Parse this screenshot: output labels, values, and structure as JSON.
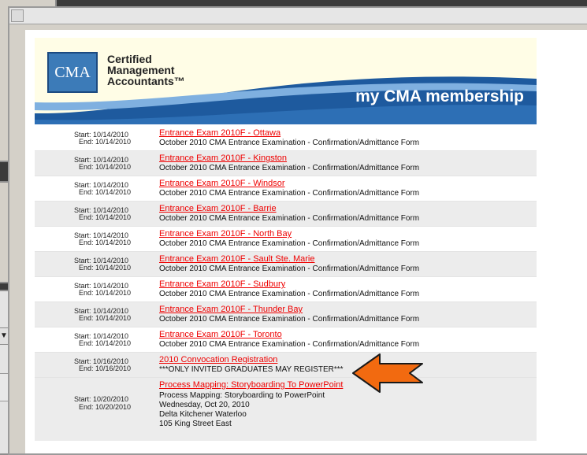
{
  "banner": {
    "logo_text": "CMA",
    "brand_lines": [
      "Certified",
      "Management",
      "Accountants™"
    ],
    "title": "my CMA membership",
    "colors": {
      "logo_blue": "#3c7bb8",
      "swoosh_blue": "#1e5a9e",
      "banner_bg": "#fffde6"
    }
  },
  "events": [
    {
      "start": "Start: 10/14/2010",
      "end": "End: 10/14/2010",
      "title": "Entrance Exam 2010F - Ottawa",
      "desc": "October 2010 CMA Entrance Examination - Confirmation/Admittance Form"
    },
    {
      "start": "Start: 10/14/2010",
      "end": "End: 10/14/2010",
      "title": "Entrance Exam 2010F - Kingston",
      "desc": "October 2010 CMA Entrance Examination - Confirmation/Admittance Form"
    },
    {
      "start": "Start: 10/14/2010",
      "end": "End: 10/14/2010",
      "title": "Entrance Exam 2010F - Windsor",
      "desc": "October 2010 CMA Entrance Examination - Confirmation/Admittance Form"
    },
    {
      "start": "Start: 10/14/2010",
      "end": "End: 10/14/2010",
      "title": "Entrance Exam 2010F - Barrie",
      "desc": "October 2010 CMA Entrance Examination - Confirmation/Admittance Form"
    },
    {
      "start": "Start: 10/14/2010",
      "end": "End: 10/14/2010",
      "title": "Entrance Exam 2010F - North Bay",
      "desc": "October 2010 CMA Entrance Examination - Confirmation/Admittance Form"
    },
    {
      "start": "Start: 10/14/2010",
      "end": "End: 10/14/2010",
      "title": "Entrance Exam 2010F - Sault Ste. Marie",
      "desc": "October 2010 CMA Entrance Examination - Confirmation/Admittance Form"
    },
    {
      "start": "Start: 10/14/2010",
      "end": "End: 10/14/2010",
      "title": "Entrance Exam 2010F - Sudbury",
      "desc": "October 2010 CMA Entrance Examination - Confirmation/Admittance Form"
    },
    {
      "start": "Start: 10/14/2010",
      "end": "End: 10/14/2010",
      "title": "Entrance Exam 2010F - Thunder Bay",
      "desc": "October 2010 CMA Entrance Examination - Confirmation/Admittance Form"
    },
    {
      "start": "Start: 10/14/2010",
      "end": "End: 10/14/2010",
      "title": "Entrance Exam 2010F - Toronto",
      "desc": "October 2010 CMA Entrance Examination - Confirmation/Admittance Form"
    },
    {
      "start": "Start: 10/16/2010",
      "end": "End: 10/16/2010",
      "title": "2010 Convocation Registration",
      "desc": "***ONLY INVITED GRADUATES MAY REGISTER***"
    }
  ],
  "last_event": {
    "start": "Start: 10/20/2010",
    "end": "End: 10/20/2010",
    "title": "Process Mapping: Storyboarding To PowerPoint",
    "lines": [
      "Process Mapping: Storyboarding to PowerPoint",
      "Wednesday, Oct 20, 2010",
      "Delta Kitchener Waterloo",
      "105 King Street East"
    ]
  },
  "background_windows": {
    "dropdown_arrow": "▼"
  },
  "annotation": {
    "arrow_color": "#f26a10",
    "arrow_outline": "#1a1a1a"
  }
}
